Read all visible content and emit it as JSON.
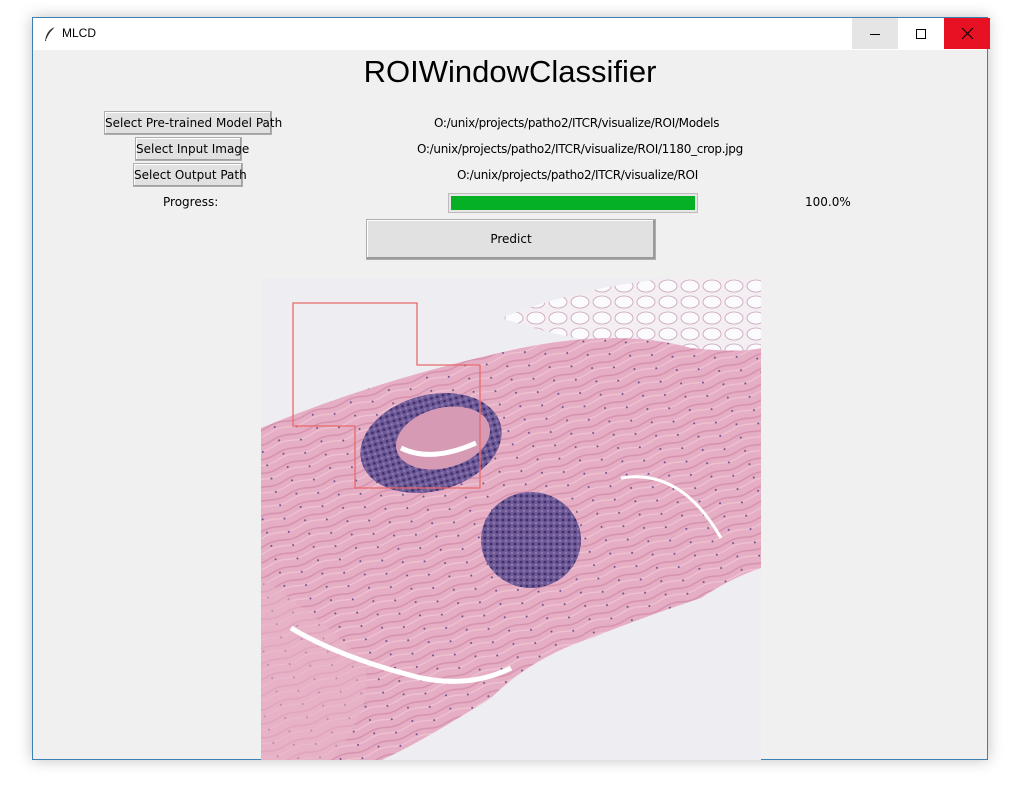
{
  "window": {
    "title": "MLCD"
  },
  "heading": "ROIWindowClassifier",
  "buttons": {
    "model": "Select Pre-trained Model Path",
    "input": "Select Input Image",
    "output": "Select Output Path",
    "predict": "Predict"
  },
  "paths": {
    "model": "O:/unix/projects/patho2/ITCR/visualize/ROI/Models",
    "input": "O:/unix/projects/patho2/ITCR/visualize/ROI/1180_crop.jpg",
    "output": "O:/unix/projects/patho2/ITCR/visualize/ROI"
  },
  "progress": {
    "label": "Progress:",
    "value": 1.0,
    "text": "100.0%"
  },
  "colors": {
    "progress_fill": "#06b025",
    "close_button": "#e81123",
    "roi_outline": "#e86a6a",
    "tissue": "#e3a8c0",
    "nuclei": "#5b4a8a"
  },
  "icons": {
    "app": "feather-icon",
    "minimize": "minimize-icon",
    "maximize": "maximize-icon",
    "close": "close-icon"
  }
}
